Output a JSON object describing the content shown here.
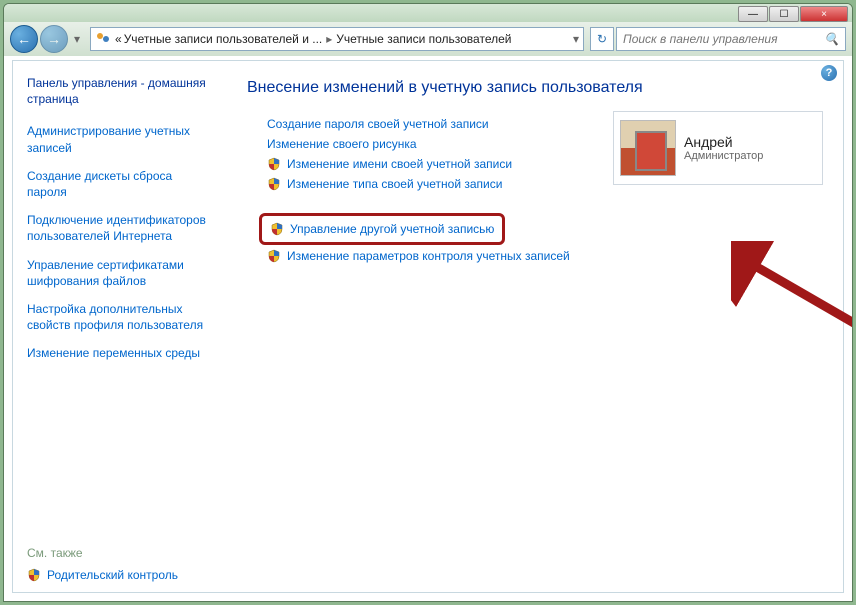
{
  "window": {
    "min_label": "—",
    "max_label": "☐",
    "close_label": "×"
  },
  "nav": {
    "back_glyph": "←",
    "fwd_glyph": "→"
  },
  "address": {
    "level1": "Учетные записи пользователей и ...",
    "level2": "Учетные записи пользователей"
  },
  "search": {
    "placeholder": "Поиск в панели управления"
  },
  "sidebar": {
    "home": "Панель управления - домашняя страница",
    "links": [
      "Администрирование учетных записей",
      "Создание дискеты сброса пароля",
      "Подключение идентификаторов пользователей Интернета",
      "Управление сертификатами шифрования файлов",
      "Настройка дополнительных свойств профиля пользователя",
      "Изменение переменных среды"
    ],
    "see_also": "См. также",
    "footer_link": "Родительский контроль"
  },
  "main": {
    "title": "Внесение изменений в учетную запись пользователя",
    "actions": [
      {
        "label": "Создание пароля своей учетной записи",
        "shield": false
      },
      {
        "label": "Изменение своего рисунка",
        "shield": false
      },
      {
        "label": "Изменение имени своей учетной записи",
        "shield": true
      },
      {
        "label": "Изменение типа своей учетной записи",
        "shield": true
      }
    ],
    "actions2": [
      {
        "label": "Управление другой учетной записью",
        "shield": true,
        "highlighted": true
      },
      {
        "label": "Изменение параметров контроля учетных записей",
        "shield": true
      }
    ]
  },
  "user": {
    "name": "Андрей",
    "role": "Администратор"
  }
}
